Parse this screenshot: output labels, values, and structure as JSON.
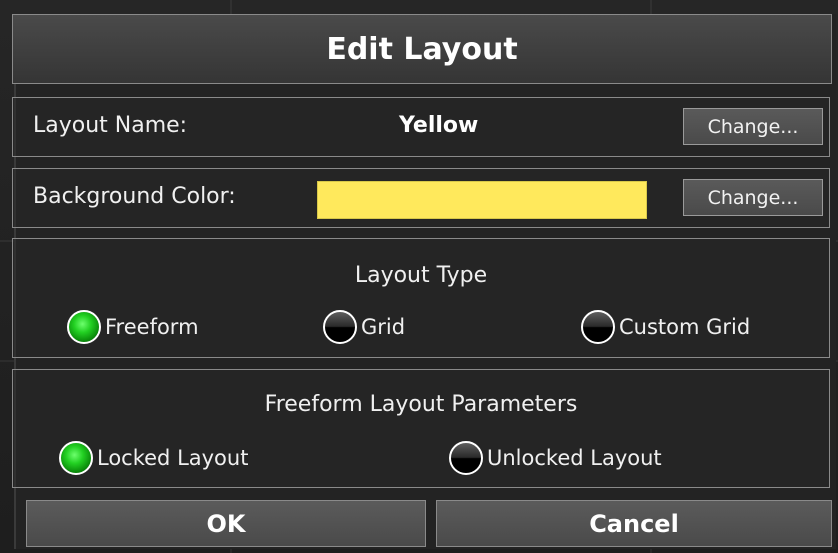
{
  "dialog": {
    "title": "Edit Layout"
  },
  "layout_name": {
    "label": "Layout Name:",
    "value": "Yellow",
    "change_label": "Change..."
  },
  "background_color": {
    "label": "Background Color:",
    "swatch_color": "#ffe95c",
    "change_label": "Change..."
  },
  "layout_type": {
    "title": "Layout Type",
    "options": [
      {
        "label": "Freeform",
        "selected": true
      },
      {
        "label": "Grid",
        "selected": false
      },
      {
        "label": "Custom Grid",
        "selected": false
      }
    ]
  },
  "freeform_params": {
    "title": "Freeform Layout Parameters",
    "options": [
      {
        "label": "Locked Layout",
        "selected": true
      },
      {
        "label": "Unlocked Layout",
        "selected": false
      }
    ]
  },
  "buttons": {
    "ok": "OK",
    "cancel": "Cancel"
  },
  "colors": {
    "accent_selected": "#22d022",
    "dialog_bg": "#232323",
    "border": "#8a8a8a"
  }
}
